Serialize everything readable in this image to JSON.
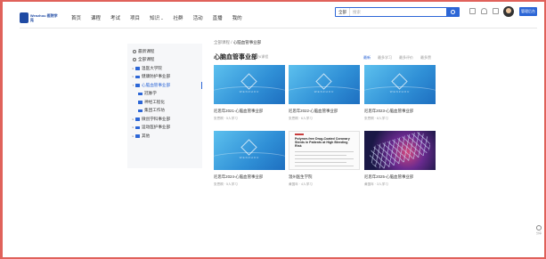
{
  "header": {
    "logo_text": "Wenzhou\n医院学苑",
    "nav": [
      "首页",
      "课程",
      "考试",
      "项目",
      "知识",
      "社群",
      "活动",
      "直播",
      "我的"
    ],
    "nav_with_arrow": "知识",
    "search": {
      "scope": "全部",
      "placeholder": "搜索"
    },
    "manage_button": "管理后台"
  },
  "sidebar": {
    "items": [
      {
        "label": "最新课程",
        "kind": "head",
        "icon": "clock-icon"
      },
      {
        "label": "全部课程",
        "kind": "head",
        "icon": "list-icon"
      },
      {
        "label": "温医大学院",
        "level": 1
      },
      {
        "label": "健康防护事业部",
        "level": 1
      },
      {
        "label": "心脑血管事业部",
        "level": 1,
        "active": true
      },
      {
        "label": "冠脉学",
        "level": 2
      },
      {
        "label": "神经工程化",
        "level": 2
      },
      {
        "label": "集团工作坊",
        "level": 2
      },
      {
        "label": "微创学科事业部",
        "level": 1
      },
      {
        "label": "运动医护事业部",
        "level": 1
      },
      {
        "label": "其他",
        "level": 1
      }
    ]
  },
  "main": {
    "breadcrumb": [
      "全部课程",
      "心脑血管事业部"
    ],
    "title": "心脑血管事业部",
    "count": "共6课程",
    "sort_tabs": [
      "最新",
      "最多学习",
      "最多评价",
      "最多赞"
    ],
    "cards": [
      {
        "title": "尼思年2021-心脑血管事业部",
        "meta": "张思桐 · 5人学习",
        "thumb": "blue"
      },
      {
        "title": "尼思年2022-心脑血管事业部",
        "meta": "张思桐 · 6人学习",
        "thumb": "blue"
      },
      {
        "title": "尼思年2023-心脑血管事业部",
        "meta": "张思桐 · 8人学习",
        "thumb": "blue"
      },
      {
        "title": "尼思年2024-心脑血管事业部",
        "meta": "张思桐 · 5人学习",
        "thumb": "blue"
      },
      {
        "title": "温州医生学院",
        "meta": "黄国年 · 4人学习",
        "thumb": "paper"
      },
      {
        "title": "尼思年2025-心脑血管事业部",
        "meta": "黄国年 · 3人学习",
        "thumb": "stent"
      }
    ],
    "paper_title": "Polymer-free Drug-Coated Coronary Stents in Patients at High Bleeding Risk",
    "thumb_brand": "WENZHOU"
  },
  "float": {
    "label": "分享"
  },
  "colors": {
    "accent": "#2c66d6",
    "frame": "#e0625b"
  }
}
